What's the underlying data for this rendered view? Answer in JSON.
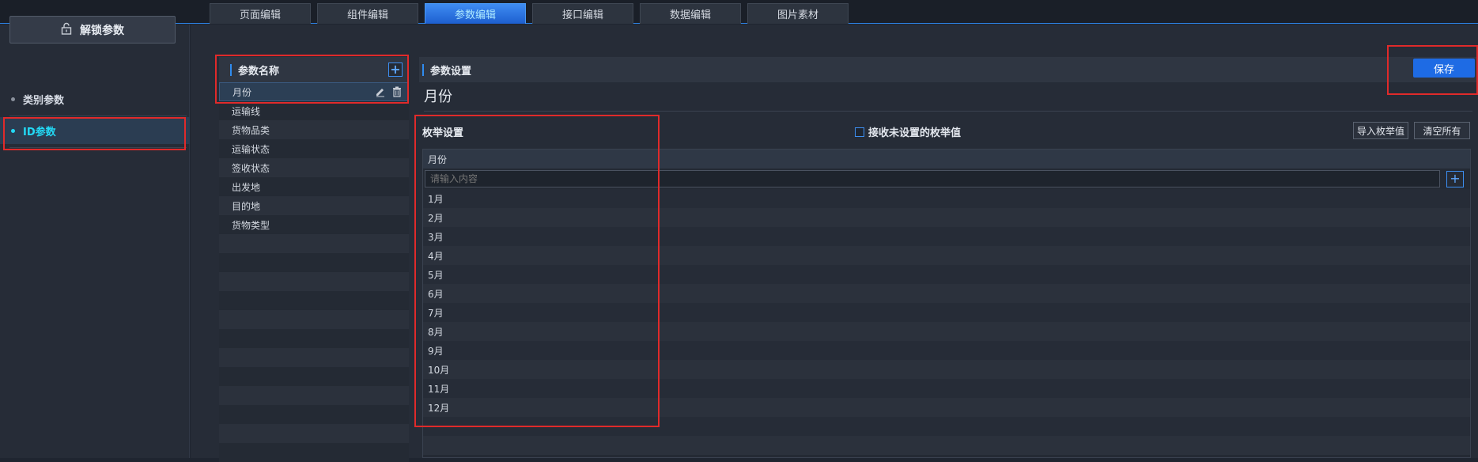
{
  "tabs": [
    {
      "label": "页面编辑",
      "active": false
    },
    {
      "label": "组件编辑",
      "active": false
    },
    {
      "label": "参数编辑",
      "active": true
    },
    {
      "label": "接口编辑",
      "active": false
    },
    {
      "label": "数据编辑",
      "active": false
    },
    {
      "label": "图片素材",
      "active": false
    }
  ],
  "sidebar": {
    "unlock_label": "解锁参数",
    "items": [
      {
        "label": "类别参数",
        "active": false
      },
      {
        "label": "ID参数",
        "active": true
      }
    ]
  },
  "param_list": {
    "title": "参数名称",
    "items": [
      "月份",
      "运输线",
      "货物品类",
      "运输状态",
      "签收状态",
      "出发地",
      "目的地",
      "货物类型"
    ]
  },
  "param_settings": {
    "title": "参数设置",
    "save_label": "保存",
    "param_name": "月份",
    "enum_label": "枚举设置",
    "accept_unset_label": "接收未设置的枚举值",
    "import_label": "导入枚举值",
    "clear_label": "清空所有",
    "table_header": "月份",
    "input_placeholder": "请输入内容",
    "enum_values": [
      "1月",
      "2月",
      "3月",
      "4月",
      "5月",
      "6月",
      "7月",
      "8月",
      "9月",
      "10月",
      "11月",
      "12月"
    ]
  },
  "colors": {
    "accent": "#1e6be4",
    "active_cyan": "#23d9f5",
    "highlight_red": "#e02a2a"
  }
}
